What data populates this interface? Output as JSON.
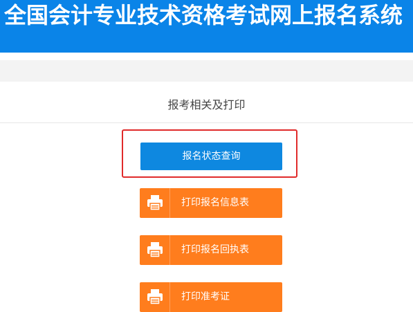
{
  "header": {
    "title": "全国会计专业技术资格考试网上报名系统"
  },
  "section": {
    "title": "报考相关及打印"
  },
  "buttons": {
    "status_query": "报名状态查询",
    "print_info": "打印报名信息表",
    "print_receipt": "打印报名回执表",
    "print_admission": "打印准考证"
  },
  "icons": {
    "printer": "printer-icon"
  },
  "colors": {
    "header_bg": "#0a84e8",
    "primary_button": "#0e88e0",
    "print_button": "#ff7d1d",
    "highlight_border": "#e02a2a"
  }
}
